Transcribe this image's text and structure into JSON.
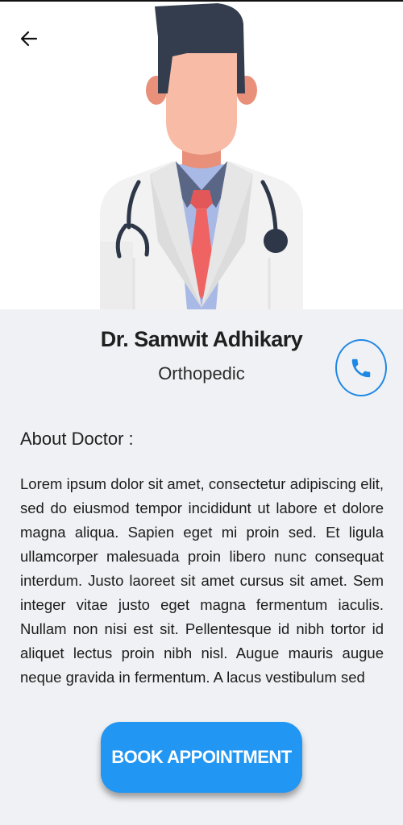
{
  "header": {
    "back_icon": "arrow-left-icon",
    "illustration": "doctor-avatar-illustration"
  },
  "doctor": {
    "name": "Dr. Samwit Adhikary",
    "specialty": "Orthopedic",
    "call_icon": "phone-icon"
  },
  "about": {
    "heading": "About Doctor :",
    "text": "Lorem ipsum dolor sit amet, consectetur adipiscing elit, sed do eiusmod tempor incididunt ut labore et dolore magna aliqua. Sapien eget mi proin sed. Et ligula ullamcorper malesuada proin libero nunc consequat interdum. Justo laoreet sit amet cursus sit amet. Sem integer vitae justo eget magna fermentum iaculis. Nullam non nisi est sit. Pellentesque id nibh tortor id aliquet lectus proin nibh nisl. Augue mauris augue neque gravida in fermentum. A lacus vestibulum sed"
  },
  "actions": {
    "book_label": "BOOK APPOINTMENT"
  },
  "colors": {
    "accent": "#2196f3",
    "call_outline": "#1e88e5",
    "background": "#f0f1f4"
  }
}
